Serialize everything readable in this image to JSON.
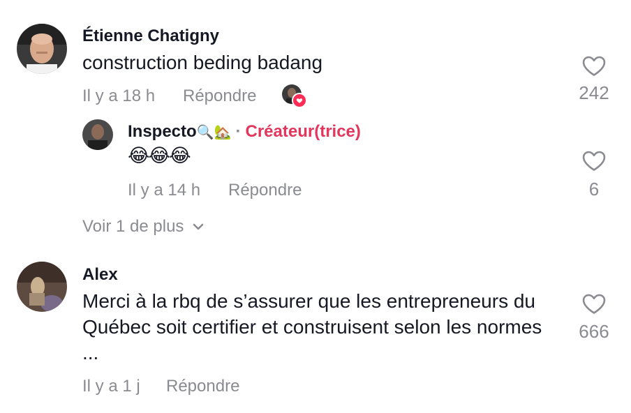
{
  "comments": [
    {
      "username": "Étienne Chatigny",
      "text": "construction beding badang",
      "time": "Il y a 18 h",
      "reply_label": "Répondre",
      "likes": "242",
      "liked_by_creator": true
    },
    {
      "username": "Alex",
      "text": "Merci à la rbq de s’assurer que les entrepreneurs du Québec soit certifier et construisent selon les normes ...",
      "time": "Il y a 1 j",
      "reply_label": "Répondre",
      "likes": "666"
    }
  ],
  "reply": {
    "username": "Inspecto",
    "username_emojis": "🔍🏡",
    "separator": "·",
    "creator_badge": "Créateur(trice)",
    "text": "😂😂😂",
    "time": "Il y a 14 h",
    "reply_label": "Répondre",
    "likes": "6"
  },
  "view_more_label": "Voir 1 de plus",
  "colors": {
    "text": "#161823",
    "secondary": "#8a8b91",
    "creator": "#e3365c",
    "heart_badge": "#fe2c55"
  },
  "icons": {
    "like": "heart-outline-icon",
    "expand": "chevron-down-icon",
    "liked_by_creator": "heart-badge-icon"
  }
}
